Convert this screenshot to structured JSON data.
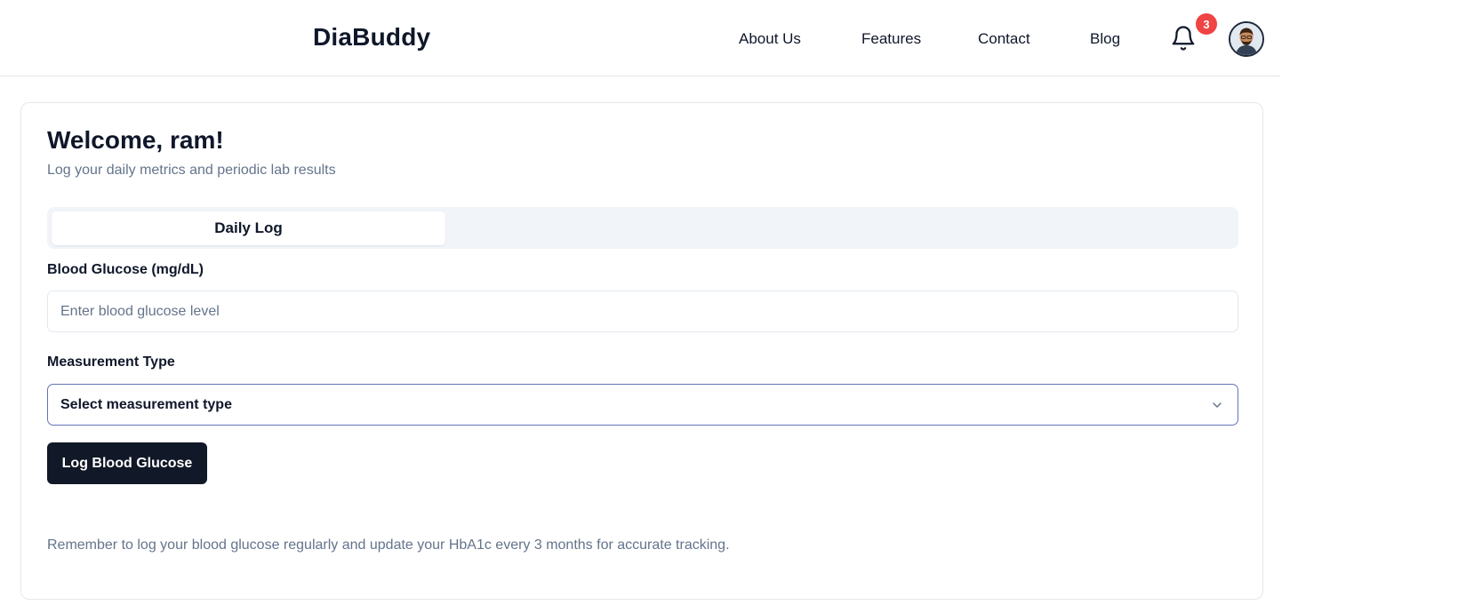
{
  "header": {
    "brand": "DiaBuddy",
    "nav": [
      "About Us",
      "Features",
      "Contact",
      "Blog"
    ],
    "notification_count": "3",
    "icons": {
      "bell": "bell-icon",
      "avatar": "user-avatar"
    }
  },
  "main": {
    "welcome": "Welcome, ram!",
    "subtitle": "Log your daily metrics and periodic lab results",
    "tabs": [
      {
        "label": "Daily Log",
        "active": true
      }
    ],
    "glucose": {
      "label": "Blood Glucose (mg/dL)",
      "placeholder": "Enter blood glucose level",
      "value": ""
    },
    "measurement": {
      "label": "Measurement Type",
      "selected": "Select measurement type"
    },
    "submit_label": "Log Blood Glucose",
    "note": "Remember to log your blood glucose regularly and update your HbA1c every 3 months for accurate tracking."
  },
  "colors": {
    "primary_button": "#111827",
    "badge": "#ef4444",
    "tab_background": "#f1f5f9",
    "select_border": "#6373b8",
    "muted_text": "#64748b"
  }
}
